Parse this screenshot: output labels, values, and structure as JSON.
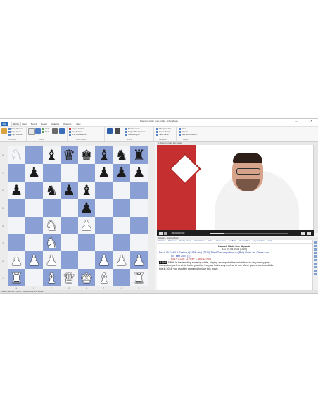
{
  "window": {
    "title": "Kasparov Main line Update - ChessBase",
    "controls": [
      "—",
      "▢",
      "✕"
    ]
  },
  "menu": {
    "file": "File",
    "items": [
      "Home",
      "Insert",
      "Board",
      "Report",
      "Analysis",
      "Opening",
      "View"
    ],
    "active": "Home"
  },
  "ribbon": {
    "clipboard": {
      "label": "Clipboard",
      "big": [
        "Paste",
        "Copy"
      ],
      "small": [
        "Paste Position",
        "Copy Game",
        "Copy Position"
      ]
    },
    "game": {
      "label": "Game",
      "big": [
        "New",
        "Next",
        "Game",
        "Save"
      ],
      "small": [
        "Undo",
        "Redo"
      ]
    },
    "find_position": {
      "label": "Find Position",
      "small": [
        "Engine Analysis",
        "Find Position",
        "Find in Reference"
      ]
    },
    "engine": {
      "label": "Engine",
      "big": [
        "Default Engine",
        "Add Kibitzer"
      ],
      "small": [
        "Blunder check",
        "Engine Management",
        "Create Engine"
      ]
    },
    "database": {
      "label": "Database",
      "small": [
        "Edit game data",
        "Game History",
        "Save Game"
      ]
    },
    "layout": {
      "label": "Layout",
      "small": [
        "Reset",
        "Threats",
        "New Board Toolbar"
      ]
    }
  },
  "board": {
    "ranks": [
      "8",
      "7",
      "6",
      "5",
      "4",
      "3",
      "2",
      "1"
    ],
    "files": [
      "a",
      "b",
      "c",
      "d",
      "e",
      "f",
      "g",
      "h"
    ],
    "rows": [
      [
        "wn-ghost",
        "",
        "bb",
        "bq",
        "bk",
        "bb",
        "bn",
        "br"
      ],
      [
        "",
        "bp",
        "",
        "",
        "",
        "bp",
        "bp",
        "bp"
      ],
      [
        "bp",
        "",
        "bn",
        "bp",
        "bb",
        "",
        "",
        ""
      ],
      [
        "",
        "",
        "",
        "",
        "bp",
        "",
        "",
        ""
      ],
      [
        "",
        "",
        "wn",
        "",
        "wp",
        "",
        "",
        ""
      ],
      [
        "",
        "",
        "wn",
        "",
        "",
        "",
        "",
        ""
      ],
      [
        "wp",
        "wp",
        "wp",
        "",
        "",
        "wp",
        "wp",
        "wp"
      ],
      [
        "wr",
        "",
        "wb",
        "wq",
        "wk",
        "wb",
        "",
        "wr"
      ]
    ]
  },
  "video": {
    "panel_title": "1. Kasparov Main line update",
    "timecode": "00:00:02:23",
    "progress": 0.18
  },
  "notation": {
    "panel_title": "Notation - Opening Book",
    "tabs": [
      "Notation",
      "Reference",
      "Replay training",
      "Plan Explorer",
      "Stats",
      "Game sheet",
      "LiveBook",
      "Opening Book",
      "My Repertoire",
      "Help"
    ],
    "heading": "Kalash Main line Update",
    "subheading": "B32  29.08.2024 (Guld)",
    "lines": [
      "Re1+ 45.Kd4 0-1 Saeliva,I (2428) (sic) (2711) Titled Tuesday intern op (Rolf) Fide Late-Chess.com",
      "INT blitz 2024 (1)",
      "Rd1+ 7.Qd4 11.Re8+ 1.Nd5 12.Nc4",
      "5.Nd6 is the trending move by white, playing a computer line which lead to very messy play.",
      "Computers prefers white but in practice, the play looks very unclear to me. Many games continued like",
      "this in 2024, you must be prepared to face this move."
    ]
  },
  "status": "Kalash Main line - (Guld) - Kasparov Main line update"
}
